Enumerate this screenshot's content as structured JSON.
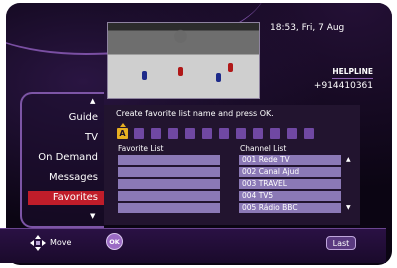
{
  "info": {
    "clock": "18:53, Fri, 7 Aug",
    "helpline_label": "HELPLINE",
    "helpline_number": "+914410361"
  },
  "menu": {
    "items": [
      {
        "label": "Guide"
      },
      {
        "label": "TV"
      },
      {
        "label": "On Demand"
      },
      {
        "label": "Messages"
      },
      {
        "label": "Favorites"
      }
    ],
    "active": "Favorites"
  },
  "editor": {
    "prompt": "Create favorite list name and press OK.",
    "current_letter": "A",
    "slot_count": 12
  },
  "favorite_list": {
    "header": "Favorite List",
    "rows": [
      "",
      "",
      "",
      "",
      ""
    ]
  },
  "channel_list": {
    "header": "Channel List",
    "channels": [
      "001 Rede TV",
      "002 Canal Ajud",
      "003 TRAVEL",
      "004 TV5",
      "005 Rádio BBC"
    ]
  },
  "footer": {
    "move_label": "Move",
    "ok_label": "OK",
    "last_label": "Last"
  },
  "colors": {
    "accent": "#7048a3",
    "active_item": "#c01d2a",
    "row": "#8b79b6",
    "highlight": "#e8b021"
  }
}
